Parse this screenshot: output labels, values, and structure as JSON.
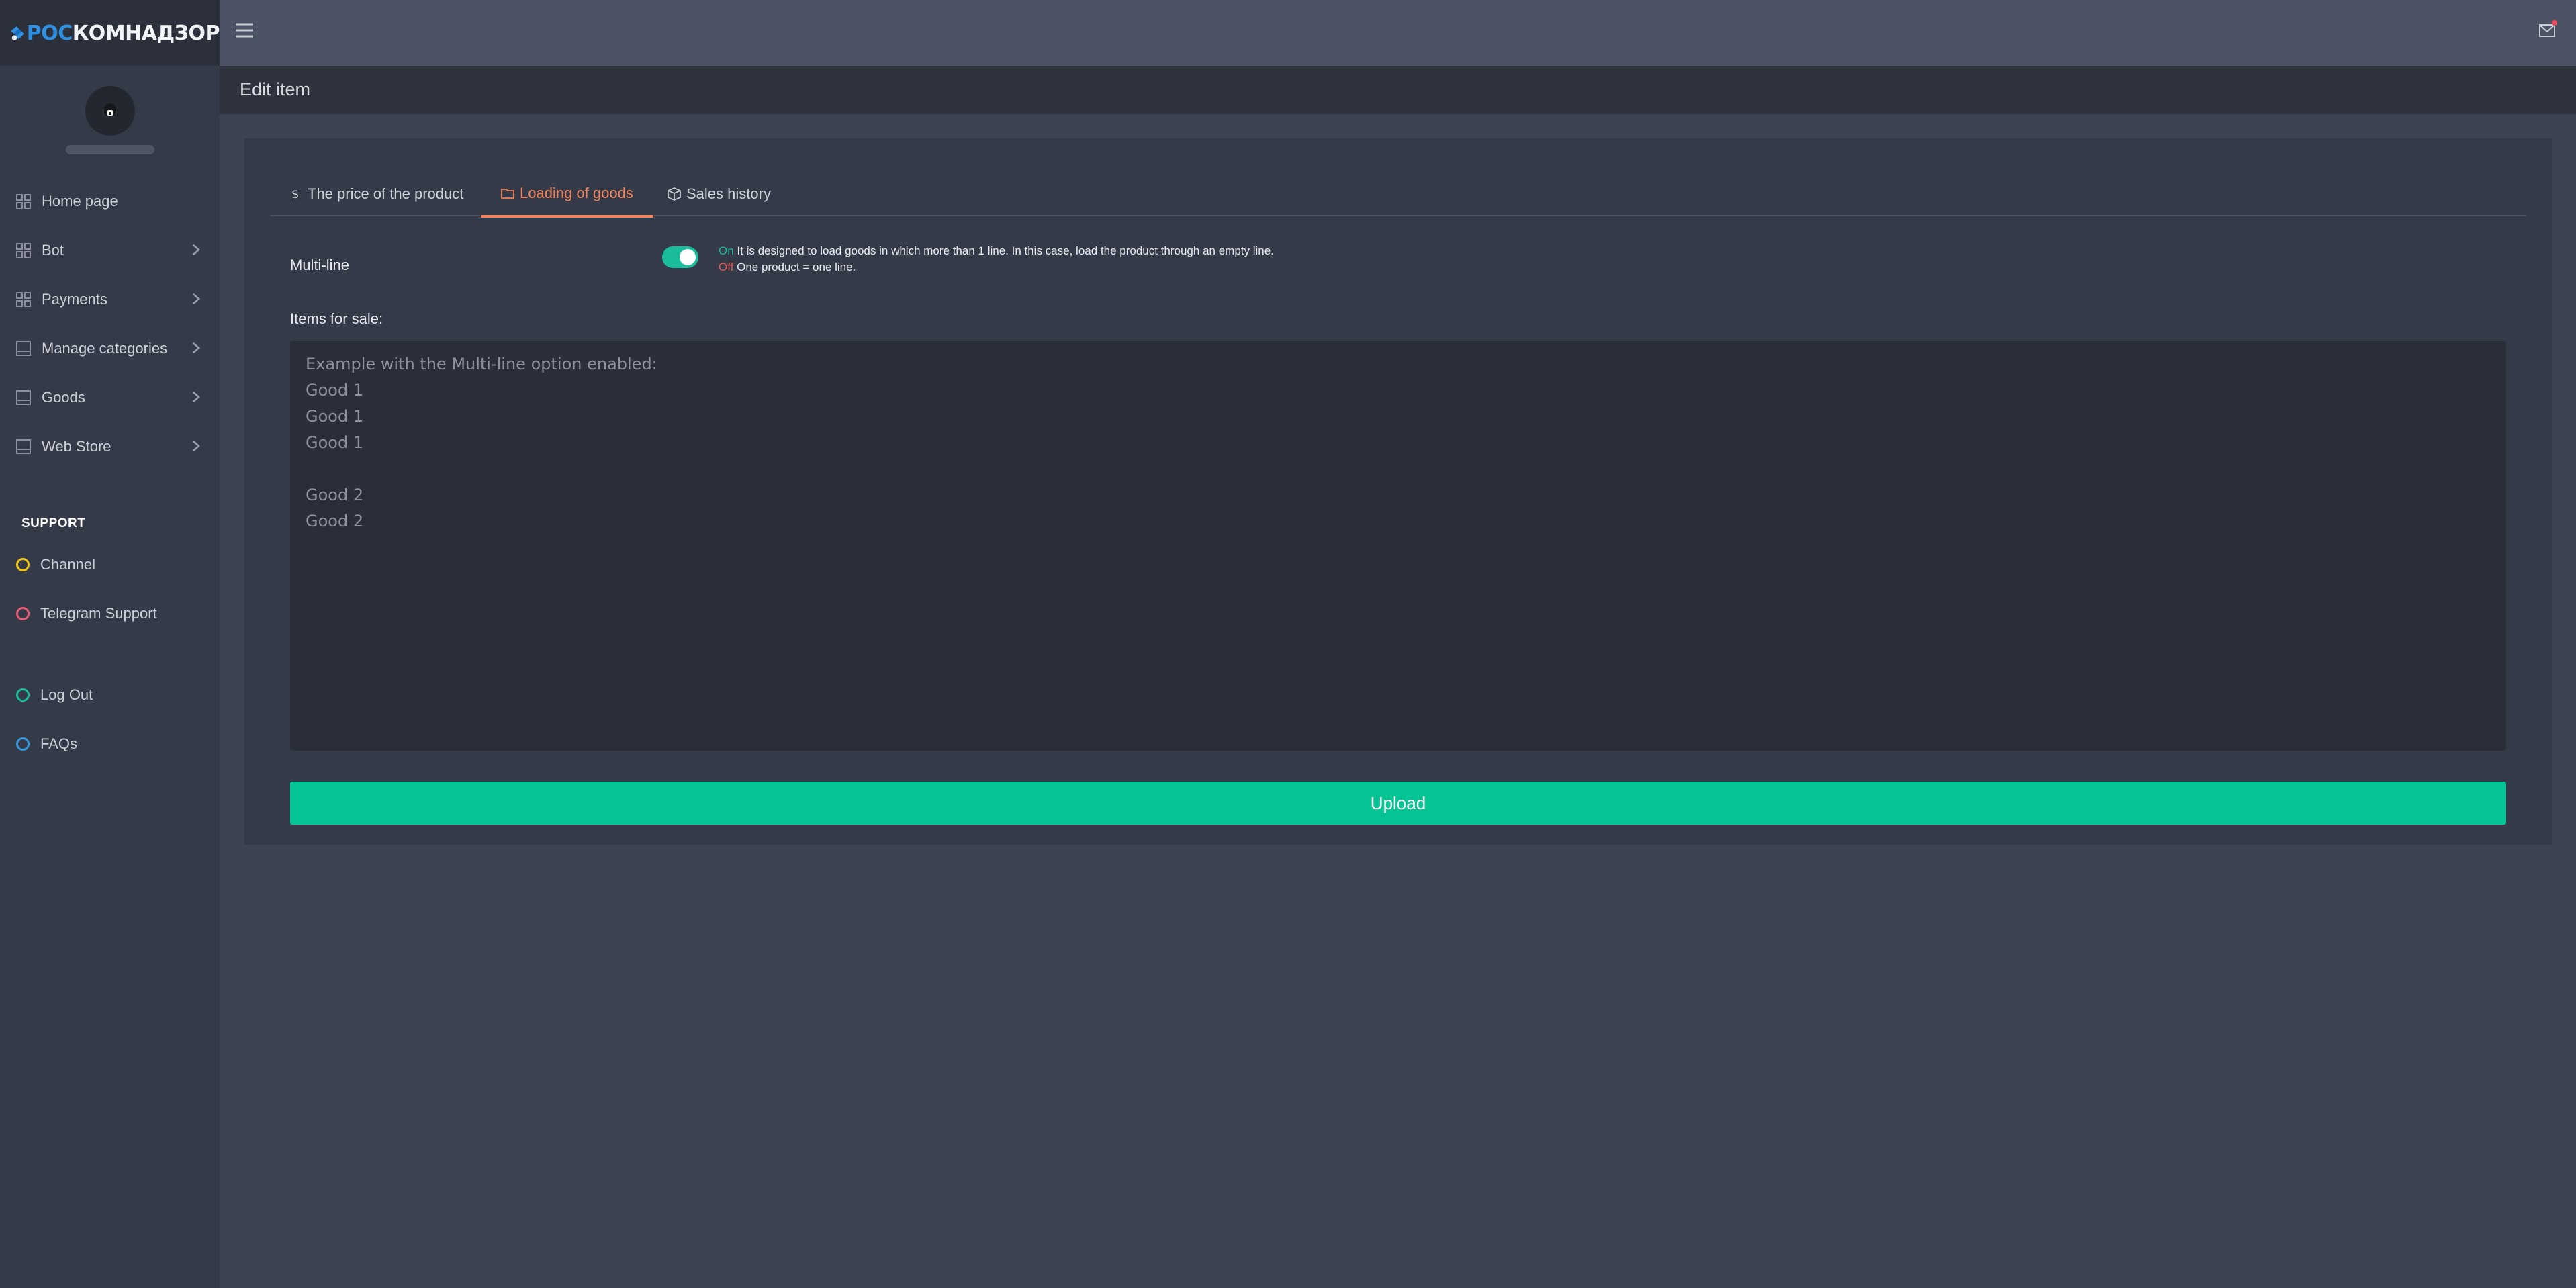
{
  "brand": {
    "logo_part1": "РОС",
    "logo_part2": "КОМНАДЗОР"
  },
  "sidebar": {
    "items": [
      {
        "label": "Home page",
        "icon": "grid-icon",
        "has_submenu": false
      },
      {
        "label": "Bot",
        "icon": "grid-icon",
        "has_submenu": true
      },
      {
        "label": "Payments",
        "icon": "grid-icon",
        "has_submenu": true
      },
      {
        "label": "Manage categories",
        "icon": "panel-icon",
        "has_submenu": true
      },
      {
        "label": "Goods",
        "icon": "panel-icon",
        "has_submenu": true
      },
      {
        "label": "Web Store",
        "icon": "panel-icon",
        "has_submenu": true
      }
    ],
    "support_title": "SUPPORT",
    "support_items": [
      {
        "label": "Channel",
        "color": "#f1c40f"
      },
      {
        "label": "Telegram Support",
        "color": "#e85d75"
      }
    ],
    "bottom_items": [
      {
        "label": "Log Out",
        "color": "#1abc9c"
      },
      {
        "label": "FAQs",
        "color": "#3498db"
      }
    ]
  },
  "header": {
    "page_title": "Edit item"
  },
  "tabs": [
    {
      "label": "The price of the product",
      "icon": "dollar-icon",
      "active": false
    },
    {
      "label": "Loading of goods",
      "icon": "folder-icon",
      "active": true
    },
    {
      "label": "Sales history",
      "icon": "box-icon",
      "active": false
    }
  ],
  "form": {
    "multiline_label": "Multi-line",
    "multiline_enabled": true,
    "hint_on_label": "On",
    "hint_on_text": " It is designed to load goods in which more than 1 line. In this case, load the product through an empty line.",
    "hint_off_label": "Off",
    "hint_off_text": " One product = one line.",
    "items_label": "Items for sale:",
    "items_placeholder": "Example with the Multi-line option enabled:\nGood 1\nGood 1\nGood 1\n\nGood 2\nGood 2",
    "items_value": "",
    "upload_label": "Upload"
  },
  "colors": {
    "accent_tab": "#f0845c",
    "primary_button": "#05c493",
    "toggle_on": "#1abc9c"
  }
}
